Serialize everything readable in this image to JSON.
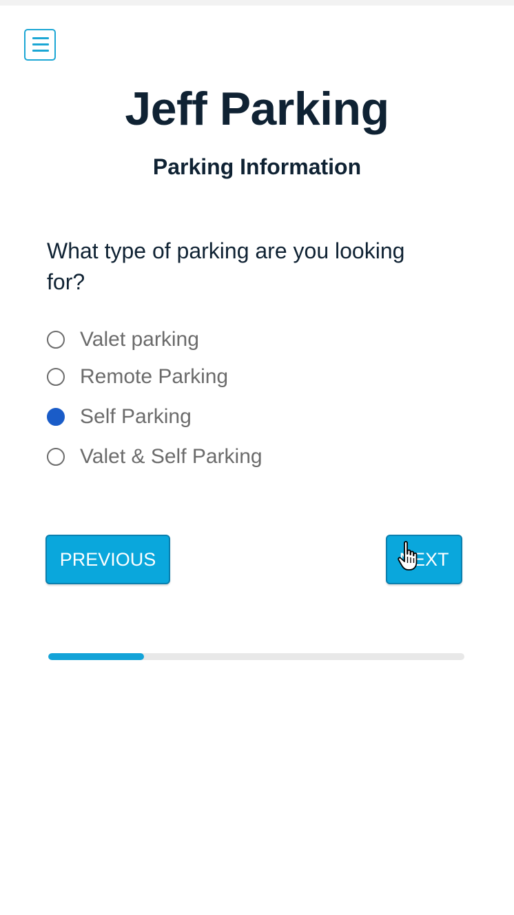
{
  "header": {
    "menu_icon": "hamburger-menu-icon",
    "title": "Jeff Parking",
    "subtitle": "Parking Information"
  },
  "form": {
    "question": "What type of parking are you looking for?",
    "options": [
      {
        "label": "Valet parking",
        "selected": false
      },
      {
        "label": "Remote Parking",
        "selected": false
      },
      {
        "label": "Self Parking",
        "selected": true
      },
      {
        "label": "Valet & Self Parking",
        "selected": false
      }
    ]
  },
  "nav": {
    "previous_label": "PREVIOUS",
    "next_label": "NEXT"
  },
  "progress": {
    "fraction": 0.23
  },
  "colors": {
    "accent": "#0aa7dc",
    "title": "#0f2233",
    "radio_selected": "#1a5cc8",
    "option_text": "#6b6b6b"
  }
}
